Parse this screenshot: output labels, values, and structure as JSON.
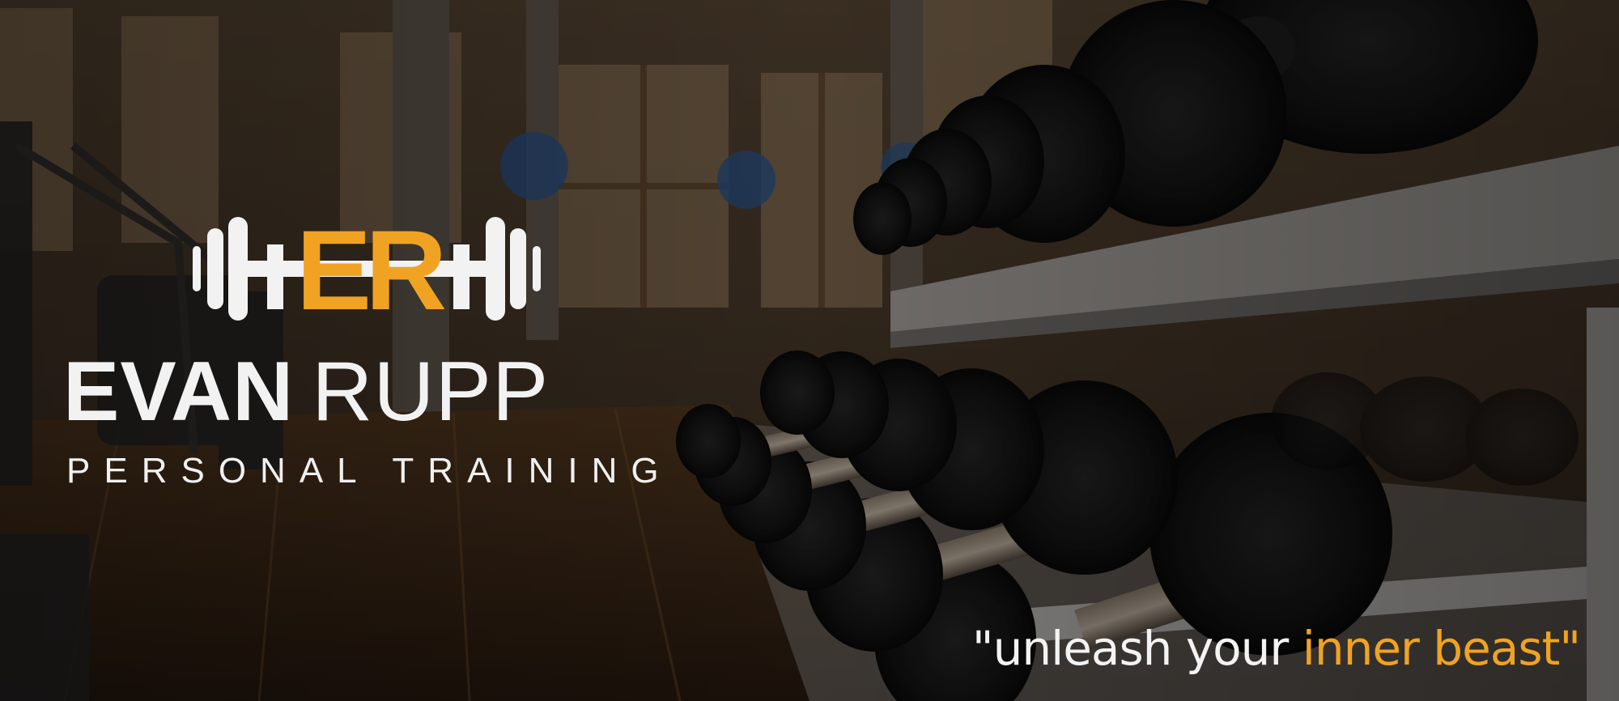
{
  "brand": {
    "monogram": "ER",
    "first_name": "EVAN",
    "last_name": "RUPP",
    "subtitle": "PERSONAL TRAINING",
    "icon": "barbell-icon"
  },
  "motto": {
    "open_quote": "\"",
    "lead": "unleash your ",
    "highlight": "inner beast",
    "close_quote": "\""
  },
  "colors": {
    "accent": "#f0a322",
    "text": "#f2f2f2"
  }
}
